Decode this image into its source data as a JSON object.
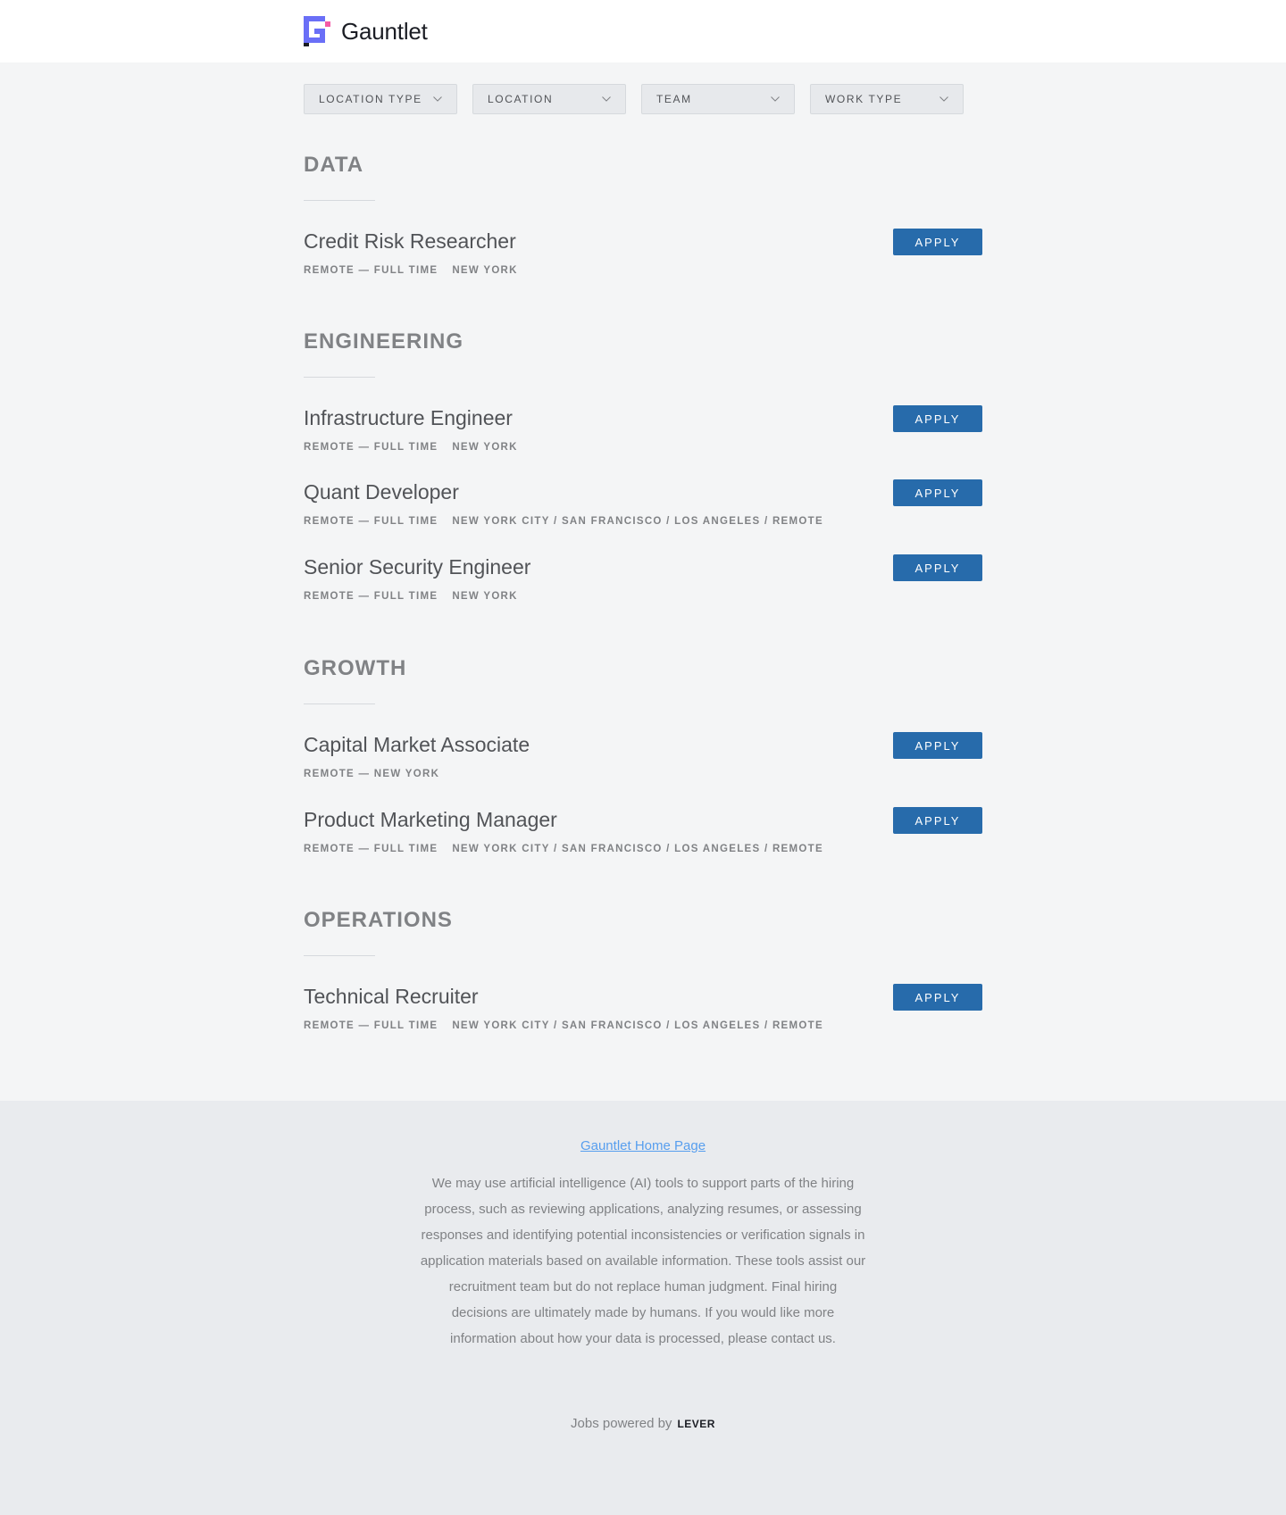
{
  "brand": {
    "name": "Gauntlet",
    "colors": {
      "logo_purple": "#6a6ff7",
      "logo_pink": "#f45aa6",
      "logo_dark": "#1b1d24"
    }
  },
  "filters": [
    {
      "label": "LOCATION TYPE",
      "icon": "chevron-down-icon"
    },
    {
      "label": "LOCATION",
      "icon": "chevron-down-icon"
    },
    {
      "label": "TEAM",
      "icon": "chevron-down-icon"
    },
    {
      "label": "WORK TYPE",
      "icon": "chevron-down-icon"
    }
  ],
  "apply_label": "APPLY",
  "groups": [
    {
      "title": "DATA",
      "postings": [
        {
          "title": "Credit Risk Researcher",
          "commitment": "REMOTE — FULL TIME",
          "location": "NEW YORK"
        }
      ]
    },
    {
      "title": "ENGINEERING",
      "postings": [
        {
          "title": "Infrastructure Engineer",
          "commitment": "REMOTE — FULL TIME",
          "location": "NEW YORK"
        },
        {
          "title": "Quant Developer",
          "commitment": "REMOTE — FULL TIME",
          "location": "NEW YORK CITY / SAN FRANCISCO / LOS ANGELES / REMOTE"
        },
        {
          "title": "Senior Security Engineer",
          "commitment": "REMOTE — FULL TIME",
          "location": "NEW YORK"
        }
      ]
    },
    {
      "title": "GROWTH",
      "postings": [
        {
          "title": "Capital Market Associate",
          "commitment": "REMOTE — NEW YORK",
          "location": ""
        },
        {
          "title": "Product Marketing Manager",
          "commitment": "REMOTE — FULL TIME",
          "location": "NEW YORK CITY / SAN FRANCISCO / LOS ANGELES / REMOTE"
        }
      ]
    },
    {
      "title": "OPERATIONS",
      "postings": [
        {
          "title": "Technical Recruiter",
          "commitment": "REMOTE — FULL TIME",
          "location": "NEW YORK CITY / SAN FRANCISCO / LOS ANGELES / REMOTE"
        }
      ]
    }
  ],
  "footer": {
    "home_link": "Gauntlet Home Page",
    "ai_notice": "We may use artificial intelligence (AI) tools to support parts of the hiring process, such as reviewing applications, analyzing resumes, or assessing responses and identifying potential inconsistencies or verification signals in application materials based on available information. These tools assist our recruitment team but do not replace human judgment. Final hiring decisions are ultimately made by humans. If you would like more information about how your data is processed, please contact us.",
    "powered_by": "Jobs powered by",
    "lever": "LEVER"
  }
}
